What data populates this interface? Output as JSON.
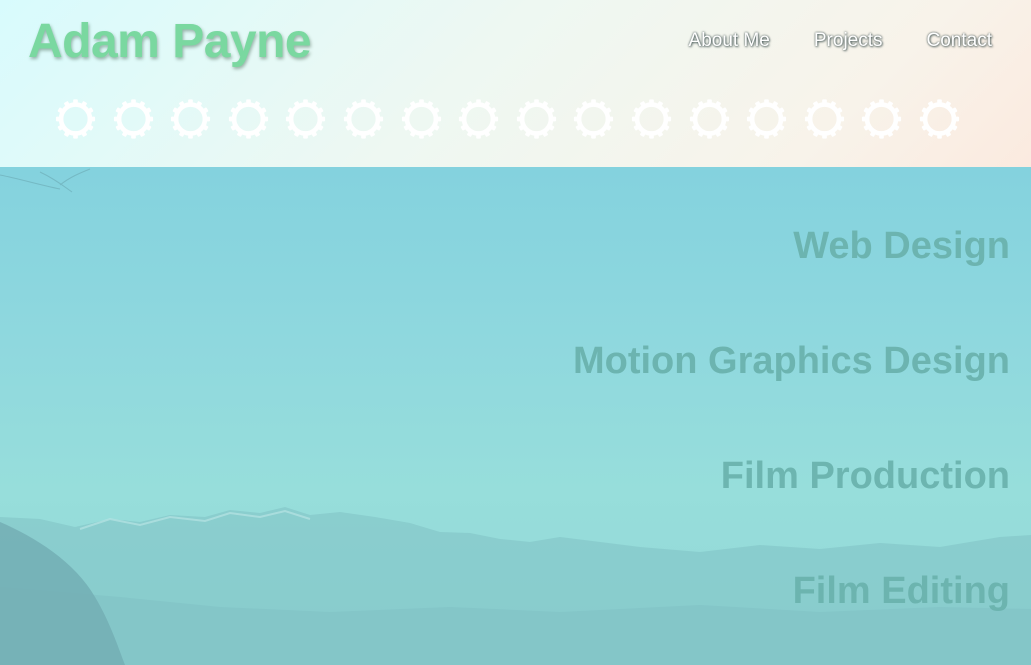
{
  "site": {
    "brand": "Adam Payne"
  },
  "nav": {
    "items": [
      {
        "label": "About Me"
      },
      {
        "label": "Projects"
      },
      {
        "label": "Contact"
      }
    ]
  },
  "decor": {
    "gear_icon": "gear-icon",
    "gear_count": 16,
    "gear_color": "#ffffff"
  },
  "hero": {
    "services": [
      {
        "label": "Web Design"
      },
      {
        "label": "Motion Graphics Design"
      },
      {
        "label": "Film Production"
      },
      {
        "label": "Film Editing"
      }
    ]
  },
  "colors": {
    "brand": "#7ad8a0",
    "service_text": "#6bb3ae",
    "hero_overlay": "#8fd8de",
    "header_background": "#eef8f2"
  }
}
